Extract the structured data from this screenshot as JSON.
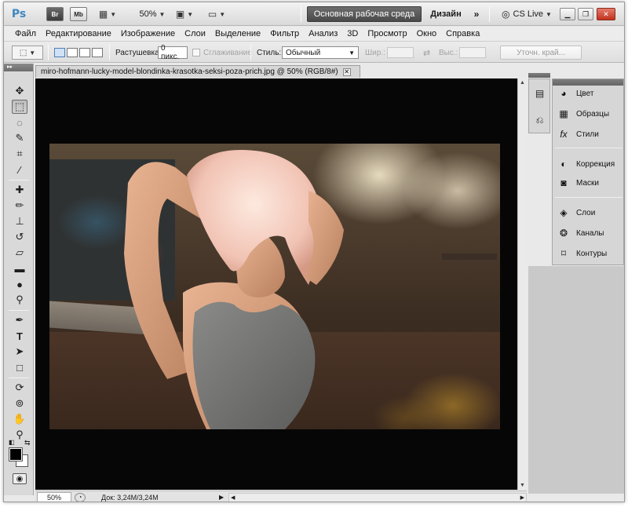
{
  "appbar": {
    "logo": "Ps",
    "bridge": "Br",
    "minibridge": "Mb",
    "zoom": "50%",
    "workspace_active": "Основная рабочая среда",
    "workspace_design": "Дизайн",
    "more": "»",
    "cs_live": "CS Live"
  },
  "menu": [
    "Файл",
    "Редактирование",
    "Изображение",
    "Слои",
    "Выделение",
    "Фильтр",
    "Анализ",
    "3D",
    "Просмотр",
    "Окно",
    "Справка"
  ],
  "options": {
    "feather_label": "Растушевка:",
    "feather_value": "0 пикс.",
    "antialias_label": "Сглаживание",
    "style_label": "Стиль:",
    "style_value": "Обычный",
    "width_label": "Шир.:",
    "height_label": "Выс.:",
    "refine_edge": "Уточн. край..."
  },
  "document": {
    "tab_title": "miro-hofmann-lucky-model-blondinka-krasotka-seksi-poza-prich.jpg @ 50% (RGB/8#)",
    "close": "✕"
  },
  "status": {
    "zoom": "50%",
    "doc_size": "Док: 3,24M/3,24M"
  },
  "panels": {
    "group1": [
      "Цвет",
      "Образцы",
      "Стили"
    ],
    "group2": [
      "Коррекция",
      "Маски"
    ],
    "group3": [
      "Слои",
      "Каналы",
      "Контуры"
    ]
  },
  "colors": {
    "foreground": "#000000",
    "background": "#ffffff",
    "workspace_button": "#5a5a5a",
    "close_button": "#c2321d"
  }
}
